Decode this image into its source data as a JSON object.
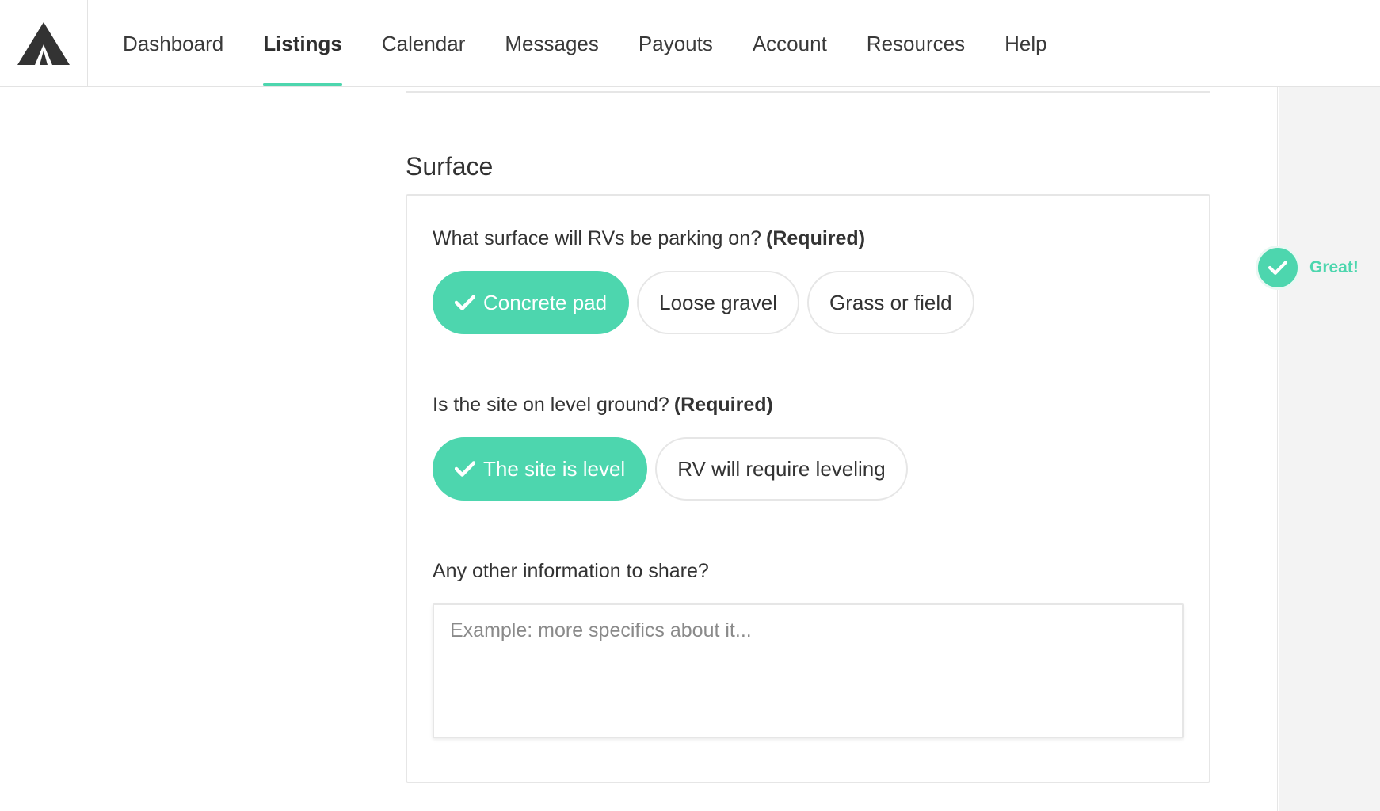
{
  "nav": {
    "items": [
      {
        "label": "Dashboard",
        "active": false
      },
      {
        "label": "Listings",
        "active": true
      },
      {
        "label": "Calendar",
        "active": false
      },
      {
        "label": "Messages",
        "active": false
      },
      {
        "label": "Payouts",
        "active": false
      },
      {
        "label": "Account",
        "active": false
      },
      {
        "label": "Resources",
        "active": false
      },
      {
        "label": "Help",
        "active": false
      }
    ]
  },
  "logo_icon": "tent-logo-icon",
  "section": {
    "title": "Surface",
    "surface_question": "What surface will RVs be parking on?",
    "surface_required": "(Required)",
    "surface_options": [
      {
        "label": "Concrete pad",
        "selected": true
      },
      {
        "label": "Loose gravel",
        "selected": false
      },
      {
        "label": "Grass or field",
        "selected": false
      }
    ],
    "level_question": "Is the site on level ground?",
    "level_required": "(Required)",
    "level_options": [
      {
        "label": "The site is level",
        "selected": true
      },
      {
        "label": "RV will require leveling",
        "selected": false
      }
    ],
    "other_question": "Any other information to share?",
    "other_placeholder": "Example: more specifics about it...",
    "other_value": ""
  },
  "status": {
    "label": "Great!",
    "icon": "check-icon"
  },
  "colors": {
    "accent": "#4dd6ae",
    "text": "#333333",
    "border": "#e6e6e6",
    "gutter": "#f3f3f3"
  }
}
